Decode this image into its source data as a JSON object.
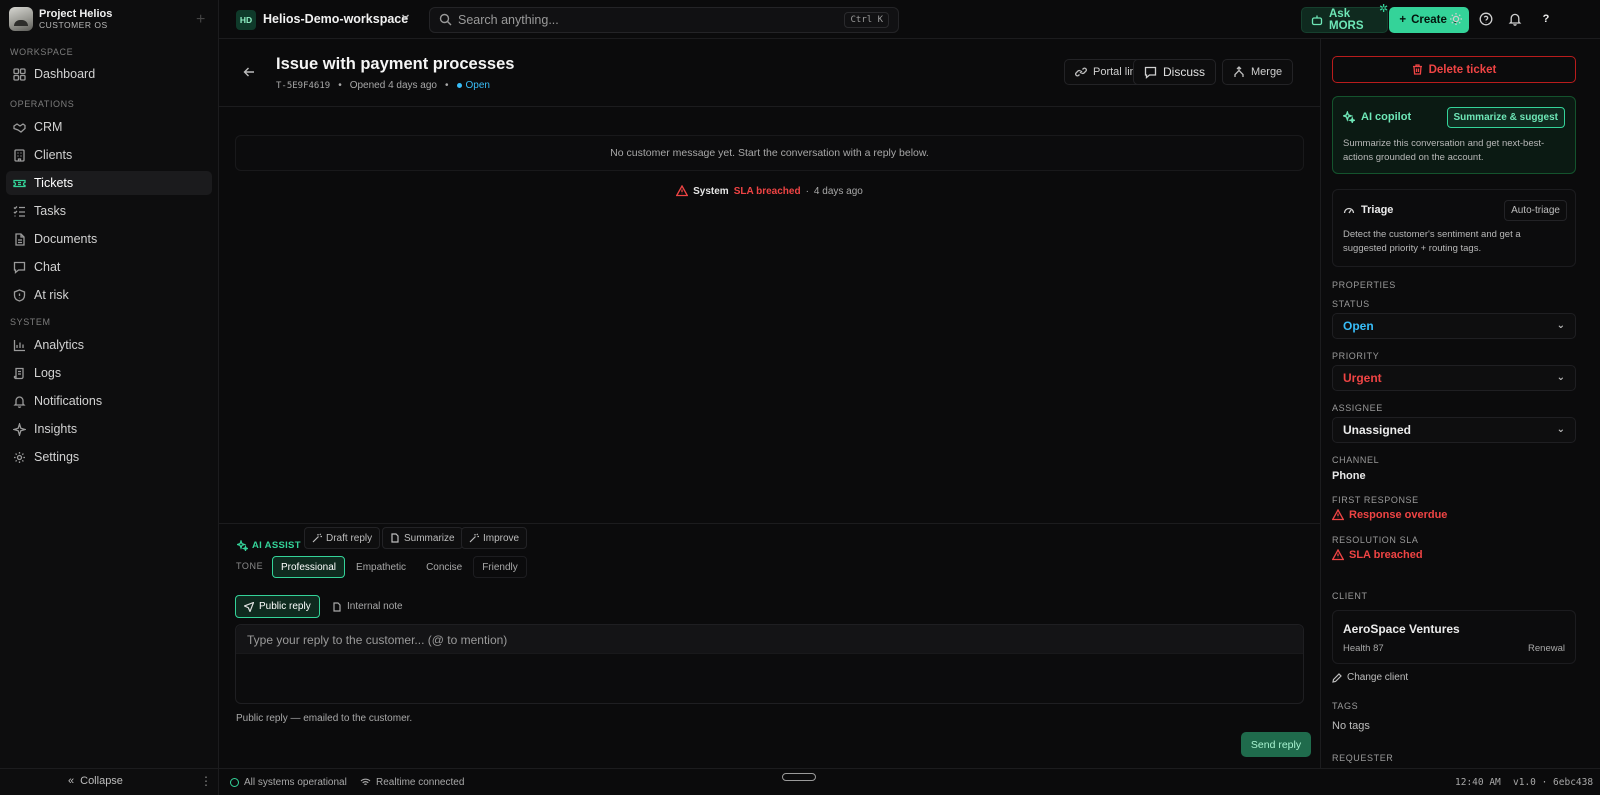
{
  "brand": {
    "name": "Project Helios",
    "sub": "CUSTOMER OS"
  },
  "sidebar": {
    "sections": {
      "workspace": "WORKSPACE",
      "operations": "OPERATIONS",
      "system": "SYSTEM"
    },
    "items": [
      {
        "label": "Dashboard",
        "icon": "dashboard-icon"
      },
      {
        "label": "CRM",
        "icon": "handshake-icon"
      },
      {
        "label": "Clients",
        "icon": "building-icon"
      },
      {
        "label": "Tickets",
        "icon": "ticket-icon",
        "active": true
      },
      {
        "label": "Tasks",
        "icon": "checklist-icon"
      },
      {
        "label": "Documents",
        "icon": "document-icon"
      },
      {
        "label": "Chat",
        "icon": "chat-icon"
      },
      {
        "label": "At risk",
        "icon": "shield-icon"
      },
      {
        "label": "Analytics",
        "icon": "bar-chart-icon"
      },
      {
        "label": "Logs",
        "icon": "scroll-icon"
      },
      {
        "label": "Notifications",
        "icon": "bell-icon"
      },
      {
        "label": "Insights",
        "icon": "sparkle-icon"
      },
      {
        "label": "Settings",
        "icon": "gear-icon"
      }
    ],
    "collapse_label": "Collapse"
  },
  "topbar": {
    "workspace_initials": "HD",
    "workspace_name": "Helios-Demo-workspace",
    "search_placeholder": "Search anything...",
    "search_shortcut": "Ctrl K",
    "ask_label": "Ask MORS",
    "create_label": "Create",
    "help_label": "?"
  },
  "ticket": {
    "title": "Issue with payment processes",
    "id": "T-5E9F4619",
    "opened": "Opened 4 days ago",
    "status": "Open",
    "actions": {
      "portal": "Portal link",
      "discuss": "Discuss",
      "merge": "Merge"
    },
    "empty_message": "No customer message yet. Start the conversation with a reply below.",
    "event": {
      "who": "System",
      "what": "SLA breached",
      "sep": "·",
      "when": "4 days ago"
    }
  },
  "composer": {
    "ai_assist": "AI ASSIST",
    "draft": "Draft reply",
    "summarize": "Summarize",
    "improve": "Improve",
    "tone_label": "TONE",
    "tones": [
      "Professional",
      "Empathetic",
      "Concise",
      "Friendly"
    ],
    "public_reply": "Public reply",
    "internal_note": "Internal note",
    "placeholder": "Type your reply to the customer... (@ to mention)",
    "hint": "Public reply — emailed to the customer.",
    "send": "Send reply"
  },
  "panel": {
    "delete": "Delete ticket",
    "copilot": {
      "title": "AI copilot",
      "button": "Summarize & suggest",
      "desc": "Summarize this conversation and get next-best-actions grounded on the account."
    },
    "triage": {
      "title": "Triage",
      "button": "Auto-triage",
      "desc": "Detect the customer's sentiment and get a suggested priority + routing tags."
    },
    "properties_label": "PROPERTIES",
    "status_label": "STATUS",
    "status_value": "Open",
    "priority_label": "PRIORITY",
    "priority_value": "Urgent",
    "assignee_label": "ASSIGNEE",
    "assignee_value": "Unassigned",
    "channel_label": "CHANNEL",
    "channel_value": "Phone",
    "first_response_label": "FIRST RESPONSE",
    "first_response_value": "Response overdue",
    "resolution_label": "RESOLUTION SLA",
    "resolution_value": "SLA breached",
    "client_label": "CLIENT",
    "client_name": "AeroSpace Ventures",
    "client_health": "Health 87",
    "client_stage": "Renewal",
    "change_client": "Change client",
    "tags_label": "TAGS",
    "tags_value": "No tags",
    "requester_label": "REQUESTER"
  },
  "statusbar": {
    "systems": "All systems operational",
    "realtime": "Realtime connected",
    "time": "12:40 AM",
    "version": "v1.0 · 6ebc438"
  },
  "colors": {
    "accent": "#34d399",
    "danger": "#ef4444",
    "info": "#38bdf8",
    "background": "#0b0b0c"
  }
}
